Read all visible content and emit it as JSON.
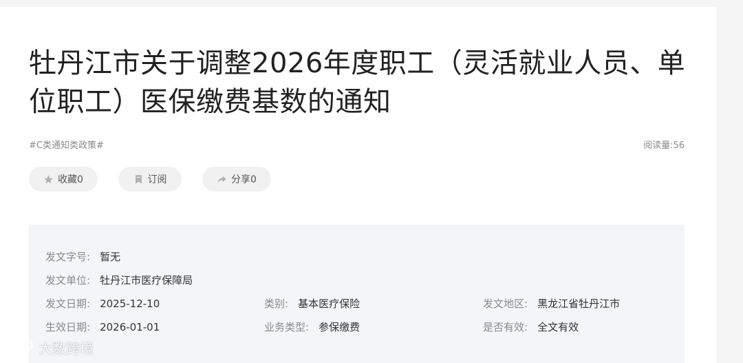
{
  "article": {
    "title": "牡丹江市关于调整2026年度职工（灵活就业人员、单位职工）医保缴费基数的通知",
    "tag": "#C类通知类政策#",
    "read_count": "阅读量:56"
  },
  "actions": {
    "favorite_label": "收藏0",
    "subscribe_label": "订阅",
    "share_label": "分享0"
  },
  "info": {
    "doc_number_label": "发文字号:",
    "doc_number_value": "暂无",
    "issuer_label": "发文单位:",
    "issuer_value": "牡丹江市医疗保障局",
    "issue_date_label": "发文日期:",
    "issue_date_value": "2025-12-10",
    "category_label": "类别:",
    "category_value": "基本医疗保险",
    "region_label": "发文地区:",
    "region_value": "黑龙江省牡丹江市",
    "effective_date_label": "生效日期:",
    "effective_date_value": "2026-01-01",
    "business_type_label": "业务类型:",
    "business_type_value": "参保缴费",
    "validity_label": "是否有效:",
    "validity_value": "全文有效"
  },
  "watermark": {
    "text": "大数跨境"
  },
  "icons": {
    "favorite": "star-icon",
    "subscribe": "bookmark-icon",
    "share": "share-arrow-icon",
    "watermark_logo": "watermark-logo-icon"
  }
}
